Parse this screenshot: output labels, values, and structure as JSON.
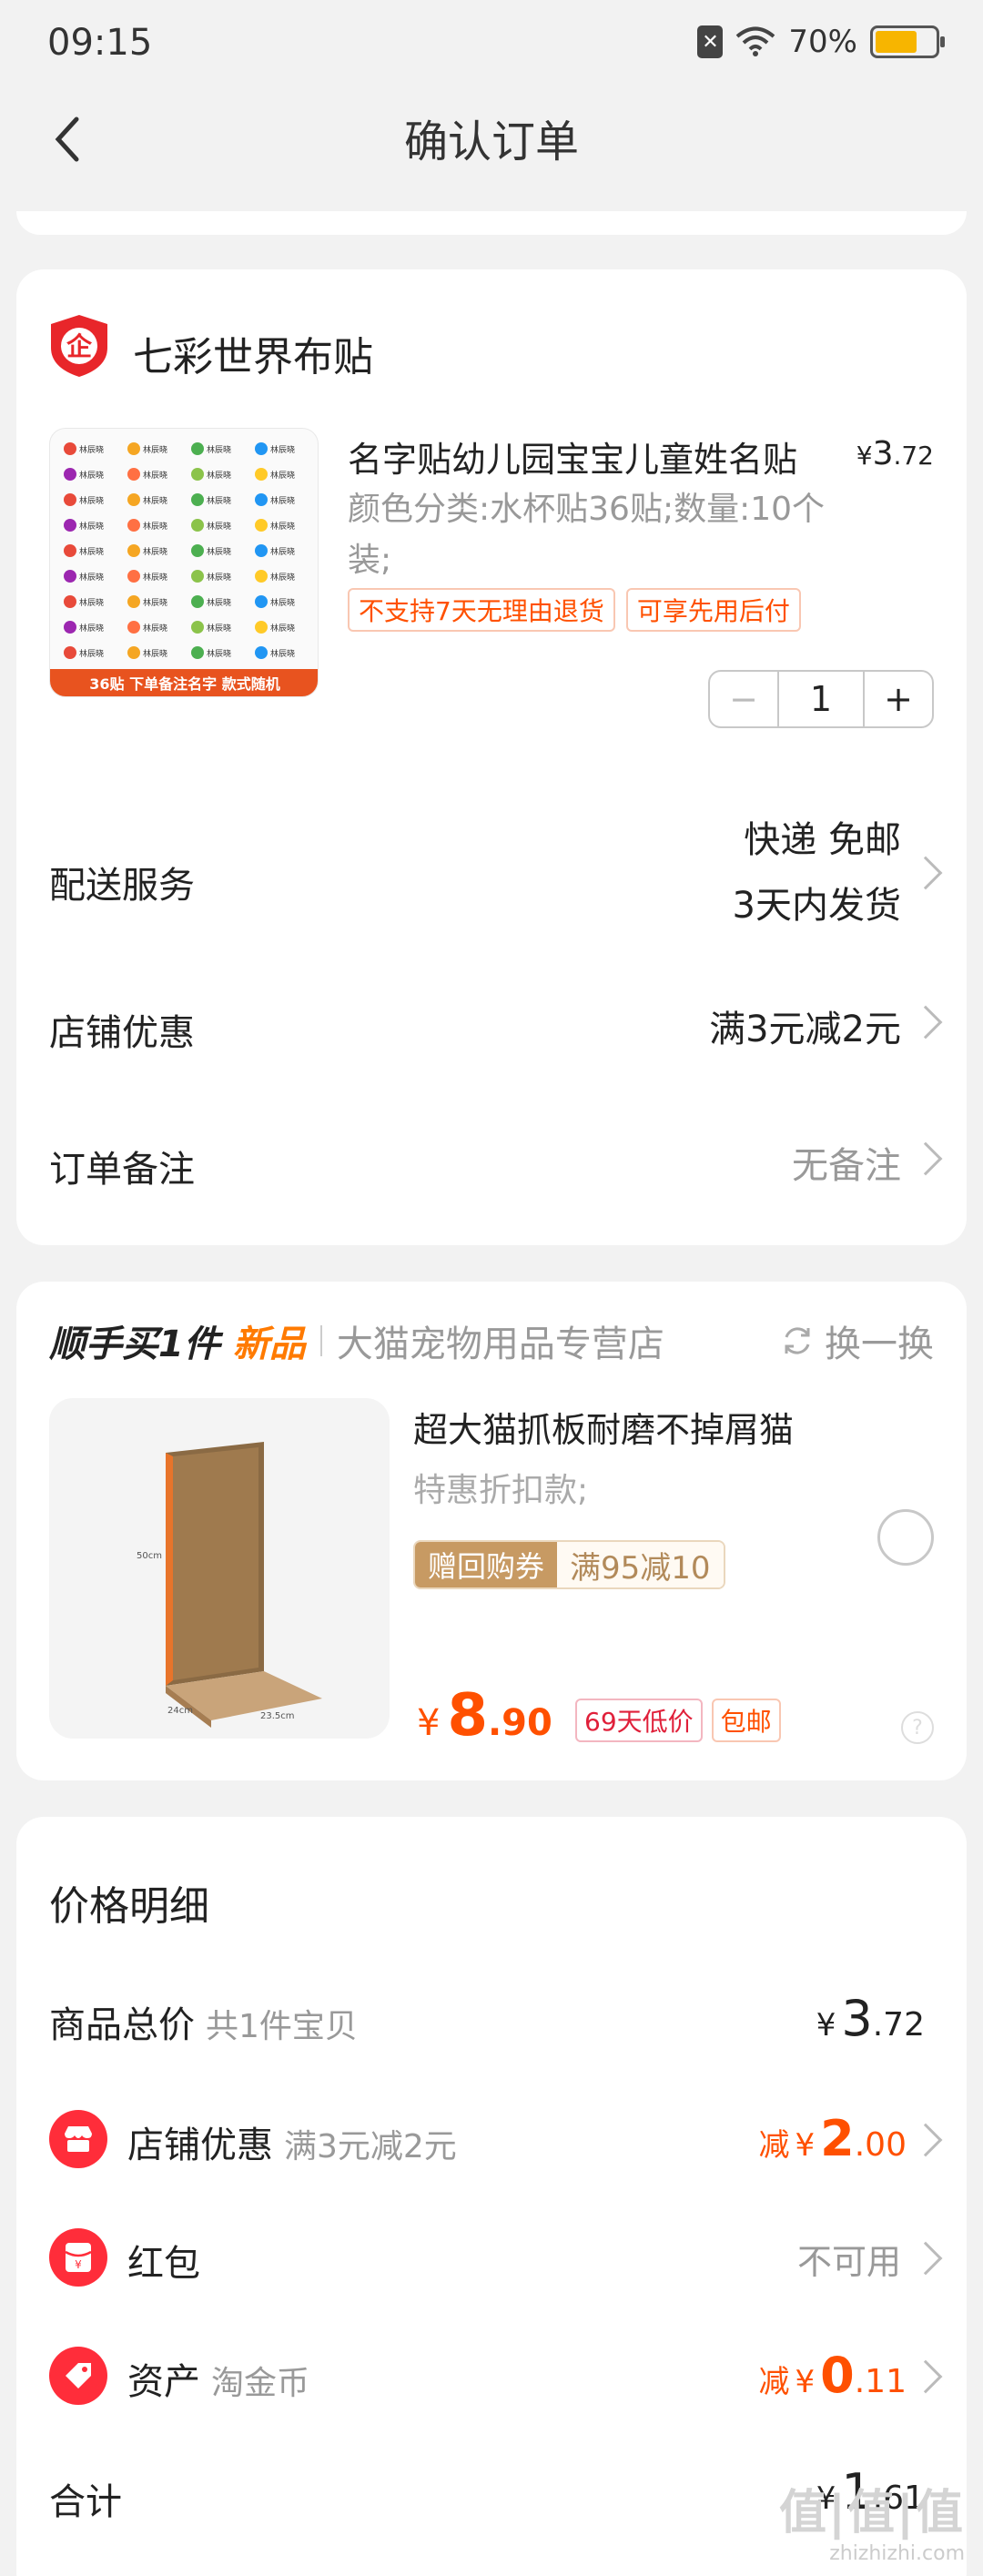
{
  "status_bar": {
    "time": "09:15",
    "battery": "70%",
    "battery_level": 0.7
  },
  "nav": {
    "title": "确认订单"
  },
  "store": {
    "name": "七彩世界布贴",
    "icon_char": "企",
    "product": {
      "title": "名字贴幼儿园宝宝儿童姓名贴",
      "price_currency": "¥",
      "price_int": "3",
      "price_dec": ".72",
      "spec": "颜色分类:水杯贴36贴;数量:10个装;",
      "tags": [
        "不支持7天无理由退货",
        "可享先用后付"
      ],
      "image_caption": "36贴  下单备注名字 款式随机",
      "sticker_text": "林辰晓",
      "quantity": "1",
      "minus": "−",
      "plus": "+"
    },
    "rows": {
      "delivery_label": "配送服务",
      "delivery_line1": "快递 免邮",
      "delivery_line2": "3天内发货",
      "discount_label": "店铺优惠",
      "discount_value": "满3元减2元",
      "note_label": "订单备注",
      "note_value": "无备注"
    }
  },
  "addon": {
    "heading": "顺手买1件",
    "new_label": "新品",
    "store": "大猫宠物用品专营店",
    "swap": "换一换",
    "title": "超大猫抓板耐磨不掉屑猫",
    "subtitle": "特惠折扣款;",
    "coupon_left": "赠回购券",
    "coupon_right": "满95减10",
    "price_currency": "¥",
    "price_int": "8",
    "price_dec": ".90",
    "badges": [
      "69天低价",
      "包邮"
    ],
    "help": "?",
    "image_dims": {
      "height": "50cm",
      "depth": "24cm",
      "width": "23.5cm"
    }
  },
  "price_detail": {
    "title": "价格明细",
    "goods_label": "商品总价",
    "goods_sub": "共1件宝贝",
    "goods_cur": "¥",
    "goods_int": "3",
    "goods_dec": ".72",
    "shop_label": "店铺优惠",
    "shop_sub": "满3元减2元",
    "shop_pre": "减",
    "shop_cur": "¥",
    "shop_int": "2",
    "shop_dec": ".00",
    "redpacket_label": "红包",
    "redpacket_value": "不可用",
    "redpacket_icon_char": "¥",
    "asset_label": "资产",
    "asset_sub": "淘金币",
    "asset_pre": "减",
    "asset_cur": "¥",
    "asset_int": "0",
    "asset_dec": ".11",
    "total_label": "合计",
    "total_cur": "¥",
    "total_int": "1",
    "total_dec": ".61"
  },
  "watermark": {
    "big": "值|值|值",
    "small": "zhizhizhi.com"
  },
  "colors": {
    "accent": "#ff5000",
    "red_icon": "#ff2d3a",
    "coupon_gold": "#c79a63"
  }
}
